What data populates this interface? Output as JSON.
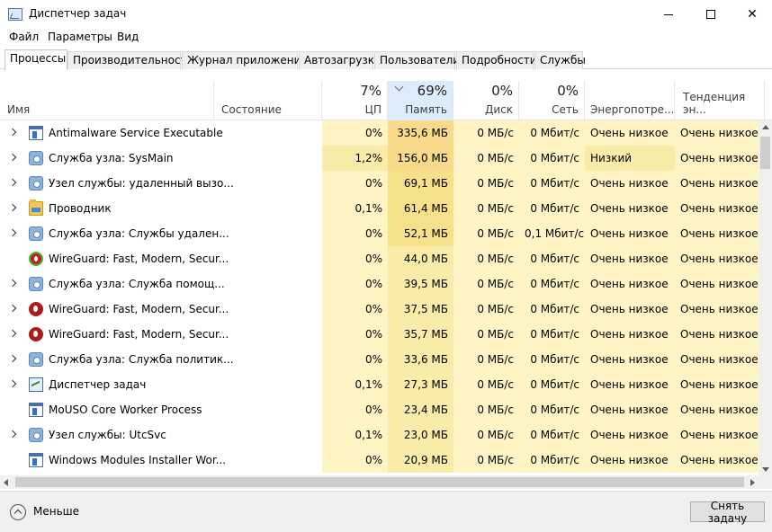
{
  "window": {
    "title": "Диспетчер задач"
  },
  "menu": [
    "Файл",
    "Параметры",
    "Вид"
  ],
  "tabs": [
    {
      "label": "Процессы",
      "active": true
    },
    {
      "label": "Производительность",
      "active": false
    },
    {
      "label": "Журнал приложений",
      "active": false
    },
    {
      "label": "Автозагрузка",
      "active": false
    },
    {
      "label": "Пользователи",
      "active": false
    },
    {
      "label": "Подробности",
      "active": false
    },
    {
      "label": "Службы",
      "active": false
    }
  ],
  "columns": {
    "name": "Имя",
    "status": "Состояние",
    "cpu": {
      "label": "ЦП",
      "total": "7%"
    },
    "memory": {
      "label": "Память",
      "total": "69%"
    },
    "disk": {
      "label": "Диск",
      "total": "0%"
    },
    "network": {
      "label": "Сеть",
      "total": "0%"
    },
    "power": "Энергопотре...",
    "power_trend": "Тенденция эн..."
  },
  "processes": [
    {
      "name": "Antimalware Service Executable",
      "icon": "window-icon",
      "expandable": true,
      "cpu": "0%",
      "memory": "335,6 МБ",
      "disk": "0 МБ/с",
      "network": "0 Мбит/с",
      "power": "Очень низкое",
      "trend": "Очень низкое"
    },
    {
      "name": "Служба узла: SysMain",
      "icon": "gear-icon",
      "expandable": true,
      "cpu": "1,2%",
      "memory": "156,0 МБ",
      "disk": "0 МБ/с",
      "network": "0 Мбит/с",
      "power": "Низкий",
      "trend": "Очень низкое"
    },
    {
      "name": "Узел службы: удаленный вызо...",
      "icon": "gear-icon",
      "expandable": true,
      "cpu": "0%",
      "memory": "69,1 МБ",
      "disk": "0 МБ/с",
      "network": "0 Мбит/с",
      "power": "Очень низкое",
      "trend": "Очень низкое"
    },
    {
      "name": "Проводник",
      "icon": "folder-icon",
      "expandable": true,
      "cpu": "0,1%",
      "memory": "61,4 МБ",
      "disk": "0 МБ/с",
      "network": "0 Мбит/с",
      "power": "Очень низкое",
      "trend": "Очень низкое"
    },
    {
      "name": "Служба узла: Службы удален...",
      "icon": "gear-icon",
      "expandable": true,
      "cpu": "0%",
      "memory": "52,1 МБ",
      "disk": "0 МБ/с",
      "network": "0,1 Мбит/с",
      "power": "Очень низкое",
      "trend": "Очень низкое"
    },
    {
      "name": "WireGuard: Fast, Modern, Secur...",
      "icon": "wireguard-icon",
      "expandable": false,
      "cpu": "0%",
      "memory": "44,0 МБ",
      "disk": "0 МБ/с",
      "network": "0 Мбит/с",
      "power": "Очень низкое",
      "trend": "Очень низкое"
    },
    {
      "name": "Служба узла: Служба помощ...",
      "icon": "gear-icon",
      "expandable": true,
      "cpu": "0%",
      "memory": "39,5 МБ",
      "disk": "0 МБ/с",
      "network": "0 Мбит/с",
      "power": "Очень низкое",
      "trend": "Очень низкое"
    },
    {
      "name": "WireGuard: Fast, Modern, Secur...",
      "icon": "wireguard-icon",
      "expandable": true,
      "cpu": "0%",
      "memory": "37,5 МБ",
      "disk": "0 МБ/с",
      "network": "0 Мбит/с",
      "power": "Очень низкое",
      "trend": "Очень низкое"
    },
    {
      "name": "WireGuard: Fast, Modern, Secur...",
      "icon": "wireguard-icon",
      "expandable": true,
      "cpu": "0%",
      "memory": "35,7 МБ",
      "disk": "0 МБ/с",
      "network": "0 Мбит/с",
      "power": "Очень низкое",
      "trend": "Очень низкое"
    },
    {
      "name": "Служба узла: Служба политик...",
      "icon": "gear-icon",
      "expandable": true,
      "cpu": "0%",
      "memory": "33,6 МБ",
      "disk": "0 МБ/с",
      "network": "0 Мбит/с",
      "power": "Очень низкое",
      "trend": "Очень низкое"
    },
    {
      "name": "Диспетчер задач",
      "icon": "task-manager-icon",
      "expandable": true,
      "cpu": "0,1%",
      "memory": "27,3 МБ",
      "disk": "0 МБ/с",
      "network": "0 Мбит/с",
      "power": "Очень низкое",
      "trend": "Очень низкое"
    },
    {
      "name": "MoUSO Core Worker Process",
      "icon": "window-icon",
      "expandable": false,
      "cpu": "0%",
      "memory": "23,4 МБ",
      "disk": "0 МБ/с",
      "network": "0 Мбит/с",
      "power": "Очень низкое",
      "trend": "Очень низкое"
    },
    {
      "name": "Узел службы: UtcSvc",
      "icon": "gear-icon",
      "expandable": true,
      "cpu": "0,1%",
      "memory": "23,0 МБ",
      "disk": "0 МБ/с",
      "network": "0 Мбит/с",
      "power": "Очень низкое",
      "trend": "Очень низкое"
    },
    {
      "name": "Windows Modules Installer Wor...",
      "icon": "window-icon",
      "expandable": false,
      "cpu": "0%",
      "memory": "20,9 МБ",
      "disk": "0 МБ/с",
      "network": "0 Мбит/с",
      "power": "Очень низкое",
      "trend": "Очень низкое"
    }
  ],
  "footer": {
    "less_label": "Меньше",
    "end_task_label": "Снять задачу"
  },
  "colors": {
    "heat_light": "#fff4c4",
    "heat_mid": "#f9eca8",
    "heat_strong": "#f7e08c",
    "heat_memory_top": "#f9d98a",
    "sorted_header": "#dcecfc"
  }
}
